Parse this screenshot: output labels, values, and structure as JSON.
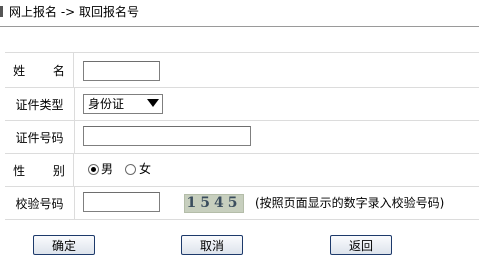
{
  "breadcrumb": {
    "text": "网上报名 -> 取回报名号"
  },
  "form": {
    "name_label": "姓 名",
    "name_value": "",
    "id_type_label": "证件类型",
    "id_type_selected": "身份证",
    "id_number_label": "证件号码",
    "id_number_value": "",
    "gender_label": "性 别",
    "gender_options": [
      "男",
      "女"
    ],
    "gender_selected": "男",
    "captcha_label": "校验号码",
    "captcha_value": "",
    "captcha_image_text": "1545",
    "captcha_hint": "(按照页面显示的数字录入校验号码)"
  },
  "buttons": {
    "confirm": "确定",
    "cancel": "取消",
    "back": "返回"
  }
}
